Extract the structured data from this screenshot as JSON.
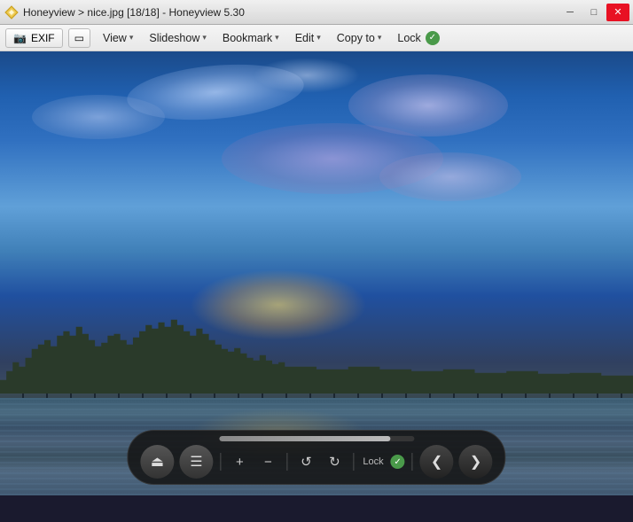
{
  "titleBar": {
    "appName": "Honeyview",
    "separator1": ">",
    "filename": "nice.jpg [18/18]",
    "separator2": "-",
    "appNameVersion": "Honeyview 5.30",
    "controls": {
      "minimize": "─",
      "maximize": "□",
      "close": "✕"
    }
  },
  "menuBar": {
    "exif": "EXIF",
    "viewIcon": "▭",
    "view": "View",
    "slideshow": "Slideshow",
    "bookmark": "Bookmark",
    "edit": "Edit",
    "copyTo": "Copy to",
    "lock": "Lock",
    "lockCheckmark": "✓",
    "arrow": "▾"
  },
  "bottomToolbar": {
    "progressPercent": 88,
    "ejectLabel": "⏏",
    "menuLabel": "☰",
    "zoomIn": "+",
    "zoomOut": "−",
    "rotateLeft": "↺",
    "rotateRight": "↻",
    "lockLabel": "Lock",
    "lockCheck": "✓",
    "prevLabel": "❮",
    "nextLabel": "❯"
  }
}
